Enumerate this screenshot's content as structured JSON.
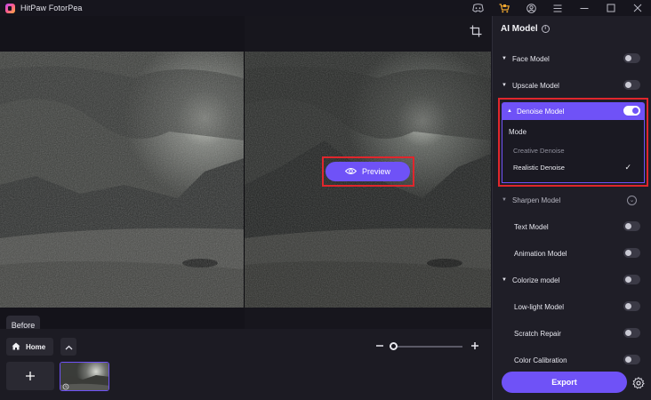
{
  "app": {
    "title": "HitPaw FotorPea"
  },
  "titlebar": {
    "icons": [
      "discord-icon",
      "cart-icon",
      "account-icon",
      "menu-icon",
      "minimize-icon",
      "maximize-icon",
      "close-icon"
    ]
  },
  "canvas": {
    "preview_label": "Preview",
    "before_label": "Before"
  },
  "bottom": {
    "home_label": "Home",
    "zoom_level": 0.05
  },
  "panel": {
    "title": "AI Model",
    "models": [
      {
        "label": "Face Model",
        "enabled": false
      },
      {
        "label": "Upscale Model",
        "enabled": false
      },
      {
        "label": "Denoise Model",
        "enabled": true
      },
      {
        "label": "Sharpen Model"
      },
      {
        "label": "Text Model",
        "enabled": false
      },
      {
        "label": "Animation Model",
        "enabled": false
      },
      {
        "label": "Colorize model",
        "enabled": false
      },
      {
        "label": "Low-light Model",
        "enabled": false
      },
      {
        "label": "Scratch Repair",
        "enabled": false
      },
      {
        "label": "Color Calibration",
        "enabled": false
      }
    ],
    "denoise": {
      "mode_label": "Mode",
      "options": [
        "Creative Denoise",
        "Realistic Denoise"
      ],
      "selected": "Realistic Denoise"
    },
    "export_label": "Export"
  },
  "colors": {
    "accent": "#6f52f7",
    "highlight": "#e0262c",
    "panel_bg": "#1f1e27"
  }
}
